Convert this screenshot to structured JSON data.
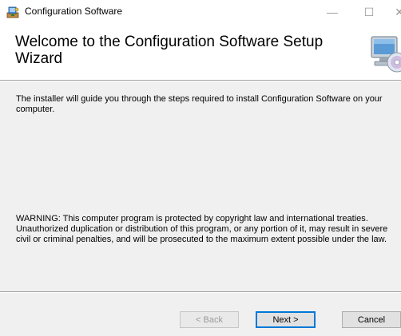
{
  "window": {
    "title": "Configuration Software",
    "minimize_glyph": "—",
    "maximize_glyph": "☐",
    "close_glyph": "✕"
  },
  "header": {
    "title": "Welcome to the Configuration Software Setup Wizard",
    "art_icon": "computer-cd-icon"
  },
  "body": {
    "intro": "The installer will guide you through the steps required to install Configuration Software on your computer.",
    "warning": "WARNING: This computer program is protected by copyright law and international treaties. Unauthorized duplication or distribution of this program, or any portion of it, may result in severe civil or criminal penalties, and will be prosecuted to the maximum extent possible under the law."
  },
  "buttons": {
    "back": "< Back",
    "next": "Next >",
    "cancel": "Cancel"
  },
  "colors": {
    "body_bg": "#f0f0f0",
    "accent": "#0078d7"
  }
}
